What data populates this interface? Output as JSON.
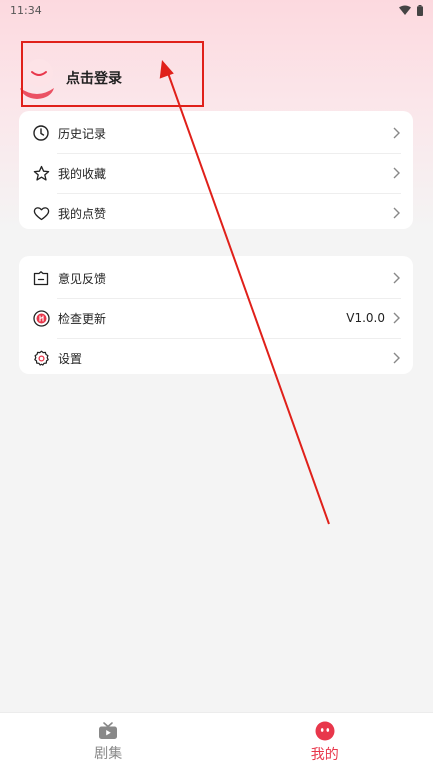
{
  "status_bar": {
    "time": "11:34"
  },
  "profile": {
    "login_label": "点击登录"
  },
  "menu_group_1": [
    {
      "label": "历史记录",
      "icon": "clock-icon"
    },
    {
      "label": "我的收藏",
      "icon": "star-icon"
    },
    {
      "label": "我的点赞",
      "icon": "heart-icon"
    }
  ],
  "menu_group_2": [
    {
      "label": "意见反馈",
      "icon": "feedback-icon",
      "value": ""
    },
    {
      "label": "检查更新",
      "icon": "update-icon",
      "value": "V1.0.0"
    },
    {
      "label": "设置",
      "icon": "gear-icon",
      "value": ""
    }
  ],
  "tabbar": {
    "drama_label": "剧集",
    "mine_label": "我的"
  },
  "colors": {
    "accent": "#e8374b",
    "annotation": "#e0201a"
  }
}
